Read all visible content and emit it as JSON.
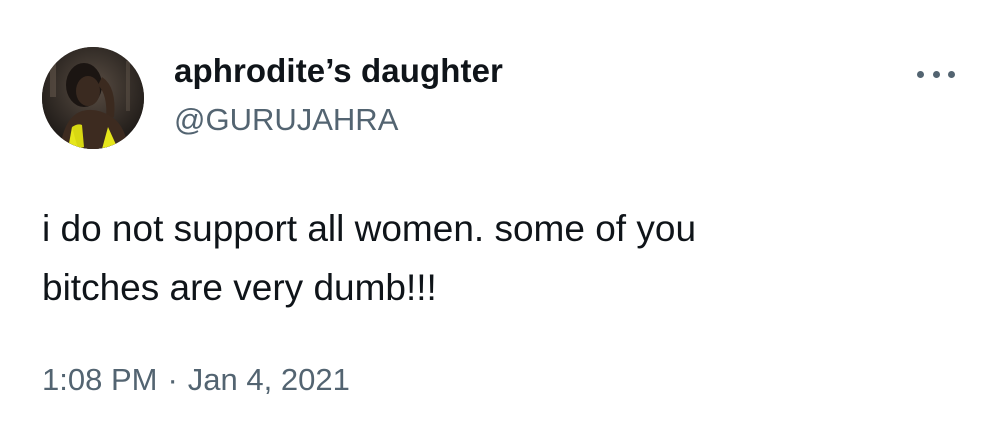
{
  "author": {
    "display_name": "aphrodite’s daughter",
    "handle": "@GURUJAHRA"
  },
  "tweet": {
    "text_lines": [
      "i do not support all women. some of you",
      "bitches are very dumb!!!"
    ],
    "time": "1:08 PM",
    "separator": "·",
    "date": "Jan 4, 2021"
  },
  "icons": {
    "more": "more-horizontal-icon"
  },
  "colors": {
    "text_primary": "#0f1419",
    "text_secondary": "#536471",
    "avatar_accent": "#e6e61a"
  }
}
